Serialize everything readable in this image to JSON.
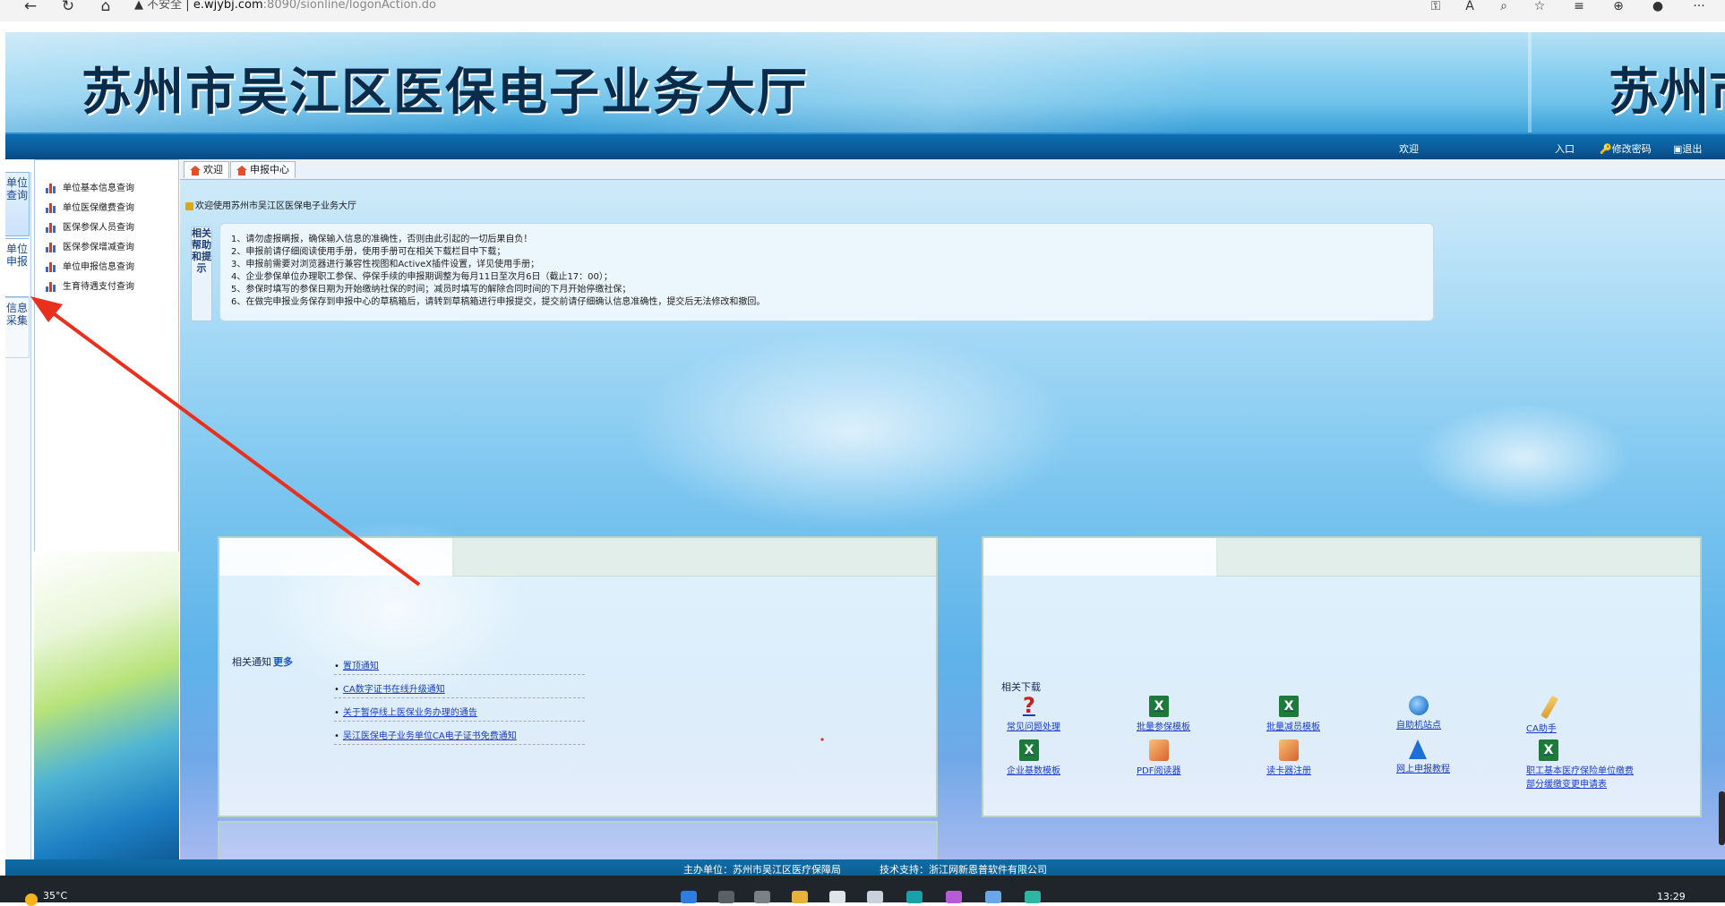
{
  "browser": {
    "security_label": "不安全",
    "url_host": "e.wjybj.com",
    "url_rest": ":8090/sionline/logonAction.do"
  },
  "header": {
    "title": "苏州市吴江区医保电子业务大厅",
    "title_repeat": "苏州市",
    "welcome": "欢迎",
    "link_exit_prefix": "入口",
    "change_password": "修改密码",
    "logout": "退出"
  },
  "left_tabs": [
    {
      "label": "单位查询"
    },
    {
      "label": "单位申报"
    },
    {
      "label": "信息采集"
    }
  ],
  "left_menu": [
    "单位基本信息查询",
    "单位医保缴费查询",
    "医保参保人员查询",
    "医保参保增减查询",
    "单位申报信息查询",
    "生育待遇支付查询"
  ],
  "tabs": [
    "欢迎",
    "申报中心"
  ],
  "welcome_text": "欢迎使用苏州市吴江区医保电子业务大厅",
  "help": {
    "label": "相关帮助和提示",
    "lines": [
      "1、请勿虚报瞒报，确保输入信息的准确性，否则由此引起的一切后果自负！",
      "2、申报前请仔细阅读使用手册，使用手册可在相关下载栏目中下载；",
      "3、申报前需要对浏览器进行兼容性视图和ActiveX插件设置，详见使用手册；",
      "4、企业参保单位办理职工参保、停保手续的申报期调整为每月11日至次月6日（截止17：00）；",
      "5、参保时填写的参保日期为开始缴纳社保的时间；减员时填写的解除合同时间的下月开始停缴社保；",
      "6、在做完申报业务保存到申报中心的草稿箱后，请转到草稿箱进行申报提交，提交前请仔细确认信息准确性，提交后无法修改和撤回。"
    ]
  },
  "notices": {
    "label": "相关通知",
    "more": "更多",
    "items": [
      "置顶通知",
      "CA数字证书在线升级通知",
      "关于暂停线上医保业务办理的通告",
      "吴江医保电子业务单位CA电子证书免费通知"
    ]
  },
  "downloads": {
    "label": "相关下载",
    "items": [
      {
        "label": "常见问题处理",
        "icon": "question-icon"
      },
      {
        "label": "批量参保模板",
        "icon": "excel-icon"
      },
      {
        "label": "批量减员模板",
        "icon": "excel-icon"
      },
      {
        "label": "自助机站点",
        "icon": "globe-icon"
      },
      {
        "label": "CA助手",
        "icon": "pencil-icon"
      },
      {
        "label": "企业基数模板",
        "icon": "excel-icon"
      },
      {
        "label": "PDF阅读器",
        "icon": "pdf-icon"
      },
      {
        "label": "读卡器注册",
        "icon": "pdf-icon"
      },
      {
        "label": "网上申报教程",
        "icon": "arrow-icon"
      },
      {
        "label": "职工基本医疗保险单位缴费部分缓缴变更申请表",
        "icon": "excel-icon"
      }
    ]
  },
  "footer": {
    "sponsor_label": "主办单位：",
    "sponsor": "苏州市吴江区医疗保障局",
    "tech_label": "技术支持：",
    "tech": "浙江网新恩普软件有限公司"
  },
  "taskbar": {
    "weather": "35°C",
    "time": "13:29"
  },
  "colors": {
    "navbar": "#0a5a99",
    "link": "#1a3cc4",
    "annotation": "#e8301c"
  }
}
